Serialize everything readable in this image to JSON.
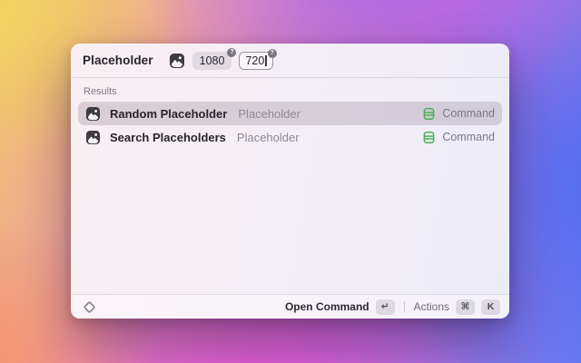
{
  "colors": {
    "accent_green": "#4fae5e",
    "selection_bg": "rgba(122,108,124,0.25)",
    "badge_bg": "#7b7680",
    "footer_key_bg": "rgba(90,80,95,0.15)"
  },
  "window": {
    "header": {
      "title": "Placeholder",
      "extension_icon": "placeholder-image-icon",
      "fields": [
        {
          "value": "1080",
          "badge": "?",
          "focused": false
        },
        {
          "value": "720",
          "badge": "?",
          "focused": true
        }
      ]
    },
    "results": {
      "section_label": "Results",
      "items": [
        {
          "title": "Random Placeholder",
          "subtitle": "Placeholder",
          "accessory_icon": "command-icon",
          "accessory_label": "Command",
          "selected": true
        },
        {
          "title": "Search Placeholders",
          "subtitle": "Placeholder",
          "accessory_icon": "command-icon",
          "accessory_label": "Command",
          "selected": false
        }
      ]
    },
    "footer": {
      "logo_icon": "raycast-logo-icon",
      "primary_action_label": "Open Command",
      "primary_action_key": "↵",
      "secondary_action_label": "Actions",
      "secondary_action_keys": [
        "⌘",
        "K"
      ]
    }
  }
}
